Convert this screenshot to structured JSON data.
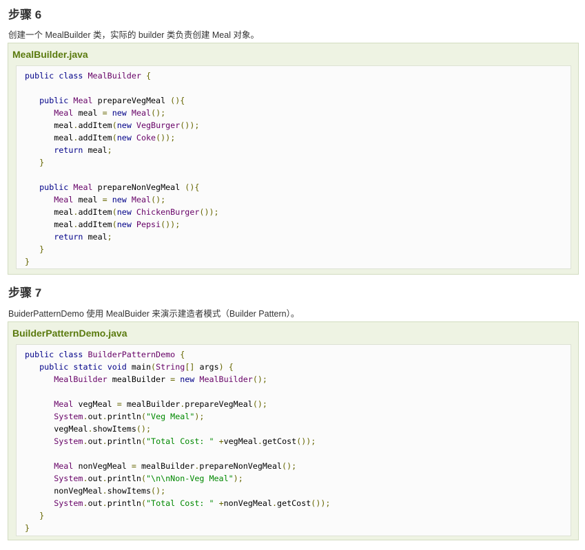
{
  "step6": {
    "heading": "步骤 6",
    "description": "创建一个 MealBuilder 类，实际的 builder 类负责创建 Meal 对象。",
    "file_name": "MealBuilder.java",
    "code_lines": [
      "public class MealBuilder {",
      "",
      "   public Meal prepareVegMeal (){",
      "      Meal meal = new Meal();",
      "      meal.addItem(new VegBurger());",
      "      meal.addItem(new Coke());",
      "      return meal;",
      "   }",
      "",
      "   public Meal prepareNonVegMeal (){",
      "      Meal meal = new Meal();",
      "      meal.addItem(new ChickenBurger());",
      "      meal.addItem(new Pepsi());",
      "      return meal;",
      "   }",
      "}"
    ]
  },
  "step7": {
    "heading": "步骤 7",
    "description": "BuiderPatternDemo 使用 MealBuider 来演示建造者模式（Builder Pattern）。",
    "file_name": "BuilderPatternDemo.java",
    "code_lines": [
      "public class BuilderPatternDemo {",
      "   public static void main(String[] args) {",
      "      MealBuilder mealBuilder = new MealBuilder();",
      "",
      "      Meal vegMeal = mealBuilder.prepareVegMeal();",
      "      System.out.println(\"Veg Meal\");",
      "      vegMeal.showItems();",
      "      System.out.println(\"Total Cost: \" +vegMeal.getCost());",
      "",
      "      Meal nonVegMeal = mealBuilder.prepareNonVegMeal();",
      "      System.out.println(\"\\n\\nNon-Veg Meal\");",
      "      nonVegMeal.showItems();",
      "      System.out.println(\"Total Cost: \" +nonVegMeal.getCost());",
      "   }",
      "}"
    ]
  },
  "colors": {
    "example_bg": "#eef3e3",
    "file_title": "#5a7a0e",
    "keyword": "#000088",
    "type": "#660066",
    "punct": "#666600",
    "string": "#008800"
  }
}
